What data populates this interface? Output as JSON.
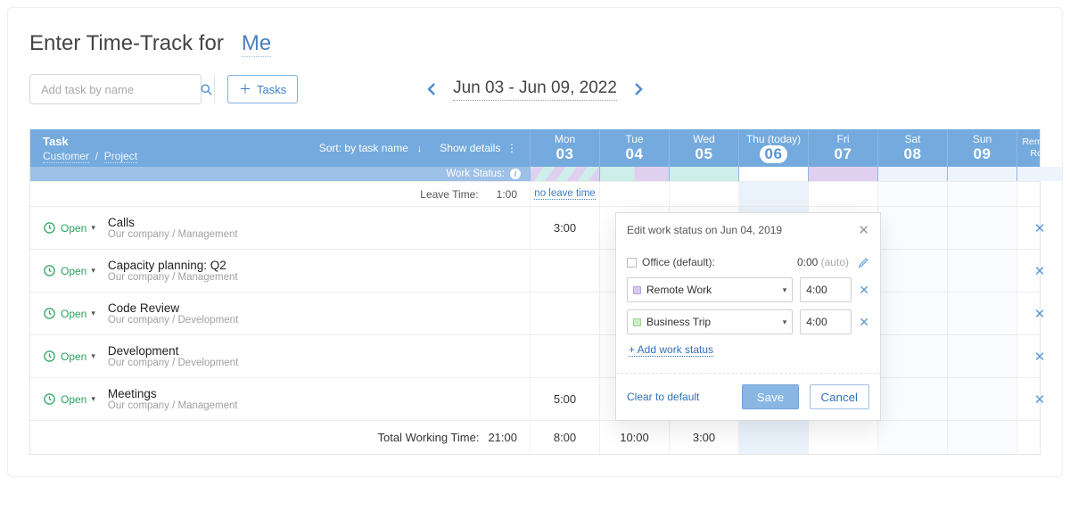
{
  "header": {
    "title_prefix": "Enter Time-Track for",
    "title_subject": "Me"
  },
  "toolbar": {
    "search_placeholder": "Add task by name",
    "tasks_btn": "Tasks",
    "date_range": "Jun 03 - Jun 09, 2022"
  },
  "table_header": {
    "task_label": "Task",
    "breadcrumb_customer": "Customer",
    "breadcrumb_sep": "/",
    "breadcrumb_project": "Project",
    "sort_label": "Sort: by task name",
    "show_details": "Show details",
    "work_status": "Work Status:",
    "remove_row_l1": "Remove",
    "remove_row_l2": "Row"
  },
  "days": [
    {
      "wd": "Mon",
      "num": "03",
      "today": false
    },
    {
      "wd": "Tue",
      "num": "04",
      "today": false
    },
    {
      "wd": "Wed",
      "num": "05",
      "today": false
    },
    {
      "wd": "Thu (today)",
      "num": "06",
      "today": true
    },
    {
      "wd": "Fri",
      "num": "07",
      "today": false
    },
    {
      "wd": "Sat",
      "num": "08",
      "today": false
    },
    {
      "wd": "Sun",
      "num": "09",
      "today": false
    }
  ],
  "leave_row": {
    "label": "Leave Time:",
    "total": "1:00",
    "mon_link": "no leave time"
  },
  "tasks": [
    {
      "status": "Open",
      "name": "Calls",
      "path": "Our company / Management",
      "cells": {
        "mon": "3:00",
        "tue": "",
        "wed": "",
        "thu": "",
        "fri": "",
        "sat": "",
        "sun": ""
      }
    },
    {
      "status": "Open",
      "name": "Capacity planning: Q2",
      "path": "Our company / Management",
      "cells": {
        "mon": "",
        "tue": "",
        "wed": "",
        "thu": "",
        "fri": "",
        "sat": "",
        "sun": ""
      }
    },
    {
      "status": "Open",
      "name": "Code Review",
      "path": "Our company / Development",
      "cells": {
        "mon": "",
        "tue": "",
        "wed": "",
        "thu": "",
        "fri": "",
        "sat": "",
        "sun": ""
      }
    },
    {
      "status": "Open",
      "name": "Development",
      "path": "Our company / Development",
      "cells": {
        "mon": "",
        "tue": "",
        "wed": "",
        "thu": "",
        "fri": "",
        "sat": "",
        "sun": ""
      }
    },
    {
      "status": "Open",
      "name": "Meetings",
      "path": "Our company / Management",
      "cells": {
        "mon": "5:00",
        "tue": "",
        "wed": "",
        "thu": "",
        "fri": "",
        "sat": "",
        "sun": ""
      }
    }
  ],
  "totals": {
    "label": "Total Working Time:",
    "overall": "21:00",
    "cells": {
      "mon": "8:00",
      "tue": "10:00",
      "wed": "3:00",
      "thu": "",
      "fri": "",
      "sat": "",
      "sun": ""
    }
  },
  "popover": {
    "title": "Edit work status on Jun 04, 2019",
    "office_label": "Office (default):",
    "office_time": "0:00",
    "office_auto": "(auto)",
    "rows": [
      {
        "name": "Remote Work",
        "time": "4:00",
        "color": "purple"
      },
      {
        "name": "Business Trip",
        "time": "4:00",
        "color": "green"
      }
    ],
    "add_link": "+ Add work status",
    "clear": "Clear to default",
    "save": "Save",
    "cancel": "Cancel"
  }
}
